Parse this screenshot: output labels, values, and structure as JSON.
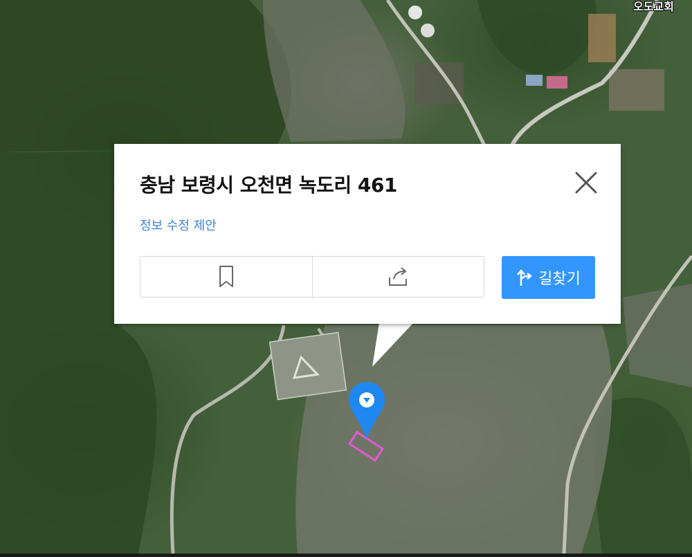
{
  "map": {
    "place_label": "오도교회"
  },
  "popup": {
    "address": "충남 보령시 오천면 녹도리 461",
    "edit_link": "정보 수정 제안",
    "directions_label": "길찾기",
    "icons": {
      "close": "close-icon",
      "bookmark": "bookmark-icon",
      "share": "share-icon",
      "directions": "directions-icon"
    }
  },
  "colors": {
    "accent": "#3396ff",
    "link": "#3b82d6",
    "marker": "#1e88f0",
    "parcel_outline": "#e25ad0"
  }
}
